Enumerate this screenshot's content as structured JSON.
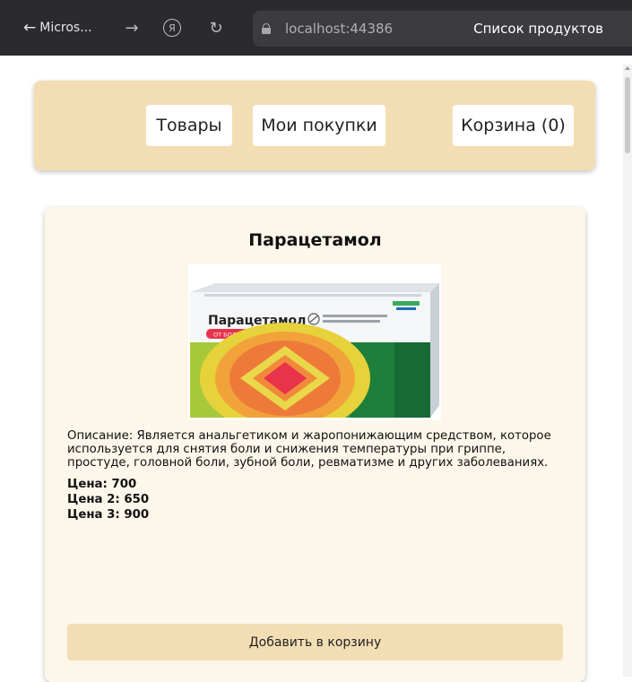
{
  "browser": {
    "back_tab_label": "Micros...",
    "url": "localhost:44386",
    "page_title": "Список продуктов"
  },
  "nav": {
    "goods_label": "Товары",
    "purchases_label": "Мои покупки",
    "cart_label": "Корзина (0)"
  },
  "product": {
    "name": "Парацетамол",
    "image_alt": "Парацетамол",
    "package_brand": "Парацетамол",
    "package_badge": "ОТ БОЛИ И ЖАРА",
    "description": "Описание: Является анальгетиком и жаропонижающим средством, которое используется для снятия боли и снижения температуры при гриппе, простуде, головной боли, зубной боли, ревматизме и других заболеваниях.",
    "price1": "Цена: 700",
    "price2": "Цена 2: 650",
    "price3": "Цена 3: 900",
    "add_button": "Добавить в корзину"
  },
  "colors": {
    "nav_bg": "#f3deb4",
    "card_bg": "#fdf6ea",
    "browser_bar": "#2b2b2f"
  }
}
